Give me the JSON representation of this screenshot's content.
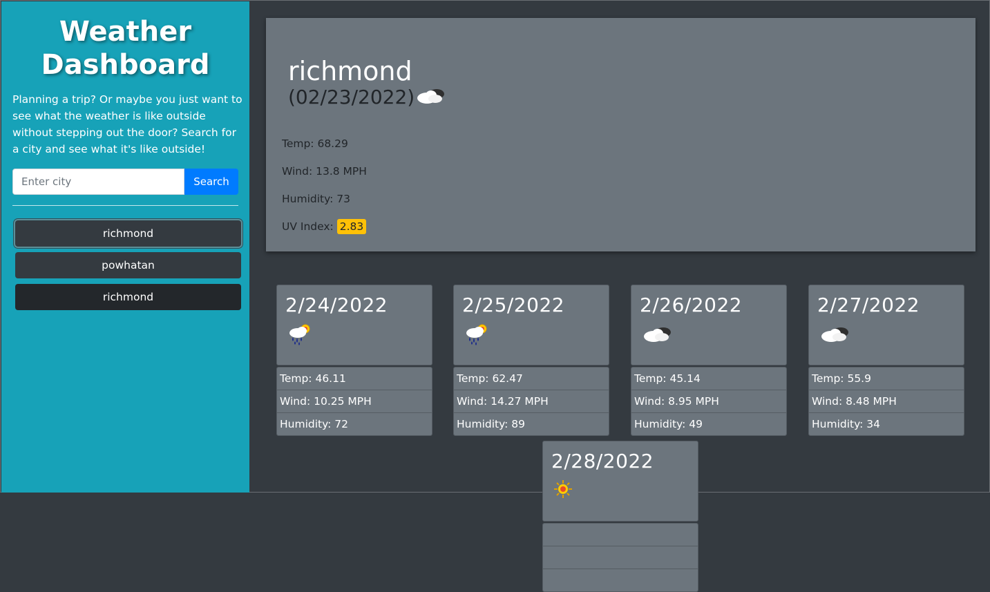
{
  "sidebar": {
    "title_line1": "Weather",
    "title_line2": "Dashboard",
    "intro": "Planning a trip? Or maybe you just want to see what the weather is like outside without stepping out the door? Search for a city and see what it's like outside!",
    "search_placeholder": "Enter city",
    "search_value": "",
    "search_button": "Search",
    "history": [
      "richmond",
      "powhatan",
      "richmond"
    ]
  },
  "current": {
    "city": "richmond",
    "date": "(02/23/2022)",
    "icon": "cloudy-icon",
    "temp": "Temp: 68.29",
    "wind": "Wind: 13.8 MPH",
    "humidity": "Humidity: 73",
    "uv_label": "UV Index:",
    "uv_value": "2.83"
  },
  "forecast": [
    {
      "date": "2/24/2022",
      "icon": "rain-sun-icon",
      "temp": "Temp: 46.11",
      "wind": "Wind: 10.25 MPH",
      "humidity": "Humidity: 72"
    },
    {
      "date": "2/25/2022",
      "icon": "rain-sun-icon",
      "temp": "Temp: 62.47",
      "wind": "Wind: 14.27 MPH",
      "humidity": "Humidity: 89"
    },
    {
      "date": "2/26/2022",
      "icon": "cloudy-icon",
      "temp": "Temp: 45.14",
      "wind": "Wind: 8.95 MPH",
      "humidity": "Humidity: 49"
    },
    {
      "date": "2/27/2022",
      "icon": "cloudy-icon",
      "temp": "Temp: 55.9",
      "wind": "Wind: 8.48 MPH",
      "humidity": "Humidity: 34"
    },
    {
      "date": "2/28/2022",
      "icon": "sun-icon",
      "temp": "",
      "wind": "",
      "humidity": ""
    }
  ],
  "colors": {
    "sidebar_bg": "#17a2b8",
    "page_bg": "#343a40",
    "card_bg": "#6c757d",
    "search_button": "#007bff",
    "uv_badge": "#ffc107"
  }
}
